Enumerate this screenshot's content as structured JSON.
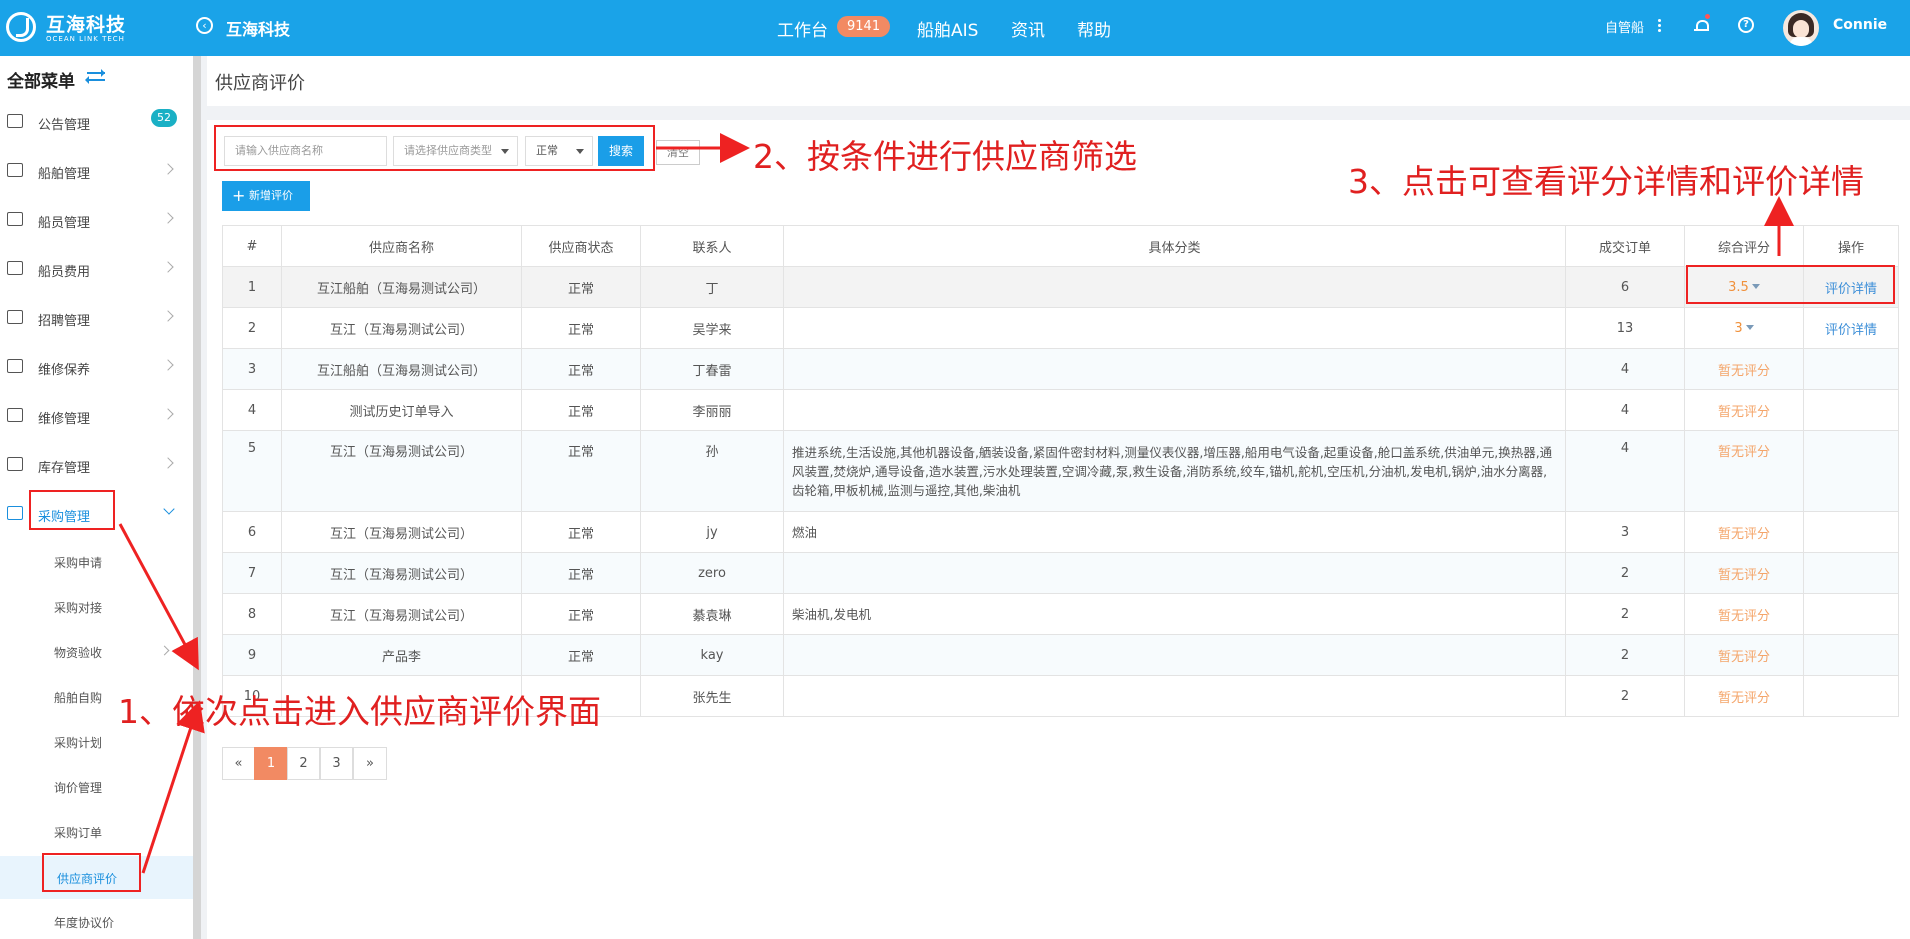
{
  "header": {
    "brand_cn": "互海科技",
    "brand_en": "OCEAN LINK TECH",
    "company": "互海科技",
    "nav": [
      {
        "label": "工作台",
        "badge": "9141"
      },
      {
        "label": "船舶AIS"
      },
      {
        "label": "资讯"
      },
      {
        "label": "帮助"
      }
    ],
    "mode": "自管船",
    "user": "Connie"
  },
  "sidebar": {
    "title": "全部菜单",
    "notice_badge": "52",
    "items": [
      {
        "label": "公告管理",
        "icon": "book-icon"
      },
      {
        "label": "船舶管理",
        "icon": "anchor-icon"
      },
      {
        "label": "船员管理",
        "icon": "person-icon"
      },
      {
        "label": "船员费用",
        "icon": "wallet-icon"
      },
      {
        "label": "招聘管理",
        "icon": "person-icon"
      },
      {
        "label": "维修保养",
        "icon": "tool-icon"
      },
      {
        "label": "维修管理",
        "icon": "wrench-icon"
      },
      {
        "label": "库存管理",
        "icon": "home-icon"
      },
      {
        "label": "采购管理",
        "icon": "cart-icon"
      }
    ],
    "sub_items": [
      "采购申请",
      "采购对接",
      "物资验收",
      "船舶自购",
      "采购计划",
      "询价管理",
      "采购订单",
      "供应商评价",
      "年度协议价"
    ]
  },
  "page": {
    "title": "供应商评价",
    "filter": {
      "name_placeholder": "请输入供应商名称",
      "type_placeholder": "请选择供应商类型",
      "status_value": "正常",
      "search_label": "搜索",
      "clear_label": "清空"
    },
    "add_label": "新增评价",
    "table": {
      "headers": [
        "#",
        "供应商名称",
        "供应商状态",
        "联系人",
        "具体分类",
        "成交订单",
        "综合评分",
        "操作"
      ],
      "rows": [
        {
          "no": "1",
          "name": "互江船舶（互海易测试公司）",
          "status": "正常",
          "contact": "丁",
          "category": "",
          "orders": "6",
          "score": "3.5",
          "action": "评价详情"
        },
        {
          "no": "2",
          "name": "互江（互海易测试公司）",
          "status": "正常",
          "contact": "吴学来",
          "category": "",
          "orders": "13",
          "score": "3",
          "action": "评价详情"
        },
        {
          "no": "3",
          "name": "互江船舶（互海易测试公司）",
          "status": "正常",
          "contact": "丁春雷",
          "category": "",
          "orders": "4",
          "score": "暂无评分",
          "action": ""
        },
        {
          "no": "4",
          "name": "测试历史订单导入",
          "status": "正常",
          "contact": "李丽丽",
          "category": "",
          "orders": "4",
          "score": "暂无评分",
          "action": ""
        },
        {
          "no": "5",
          "name": "互江（互海易测试公司）",
          "status": "正常",
          "contact": "孙",
          "category": "推进系统,生活设施,其他机器设备,舾装设备,紧固件密封材料,测量仪表仪器,增压器,船用电气设备,起重设备,舱口盖系统,供油单元,换热器,通风装置,焚烧炉,通导设备,造水装置,污水处理装置,空调冷藏,泵,救生设备,消防系统,绞车,锚机,舵机,空压机,分油机,发电机,锅炉,油水分离器,齿轮箱,甲板机械,监测与遥控,其他,柴油机",
          "orders": "4",
          "score": "暂无评分",
          "action": ""
        },
        {
          "no": "6",
          "name": "互江（互海易测试公司）",
          "status": "正常",
          "contact": "jy",
          "category": "燃油",
          "orders": "3",
          "score": "暂无评分",
          "action": ""
        },
        {
          "no": "7",
          "name": "互江（互海易测试公司）",
          "status": "正常",
          "contact": "zero",
          "category": "",
          "orders": "2",
          "score": "暂无评分",
          "action": ""
        },
        {
          "no": "8",
          "name": "互江（互海易测试公司）",
          "status": "正常",
          "contact": "綦袁琳",
          "category": "柴油机,发电机",
          "orders": "2",
          "score": "暂无评分",
          "action": ""
        },
        {
          "no": "9",
          "name": "产品李",
          "status": "正常",
          "contact": "kay",
          "category": "",
          "orders": "2",
          "score": "暂无评分",
          "action": ""
        },
        {
          "no": "10",
          "name": "",
          "status": "",
          "contact": "张先生",
          "category": "",
          "orders": "2",
          "score": "暂无评分",
          "action": ""
        }
      ]
    },
    "pagination": [
      "«",
      "1",
      "2",
      "3",
      "»"
    ],
    "current_page": "1"
  },
  "annotations": {
    "step1": "1、依次点击进入供应商评价界面",
    "step2": "2、按条件进行供应商筛选",
    "step3": "3、点击可查看评分详情和评价详情",
    "color": "#ee2222"
  },
  "colors": {
    "topbar": "#1aa3e8",
    "accent": "#1a9ee8",
    "badge": "#f28a63",
    "score": "#f0913c"
  }
}
